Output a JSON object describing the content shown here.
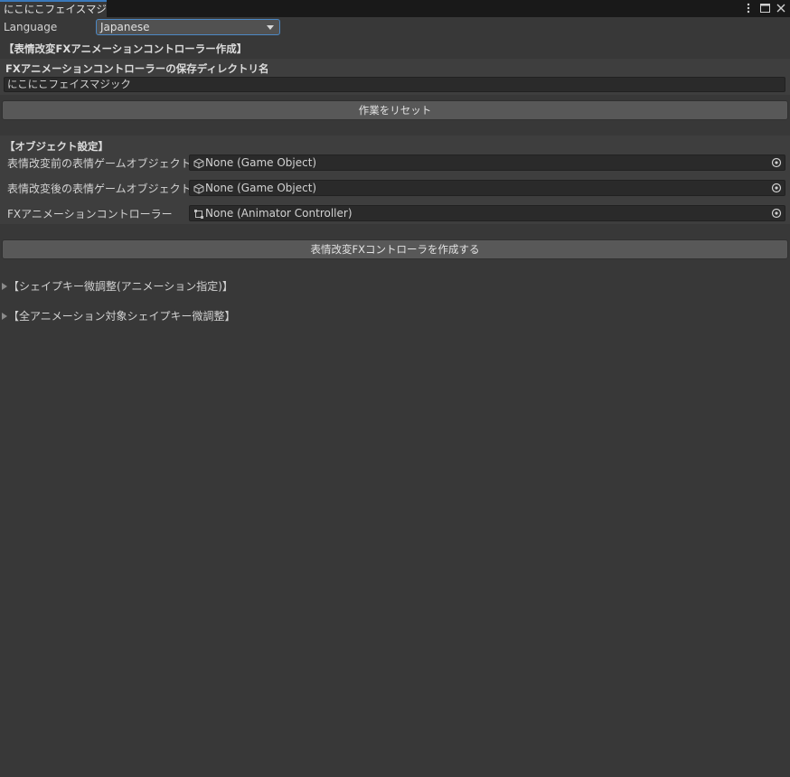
{
  "window": {
    "tab_title": "にこにこフェイスマジック",
    "controls": [
      "kebab-menu-icon",
      "maximize-icon",
      "close-icon"
    ]
  },
  "language": {
    "label": "Language",
    "selected": "Japanese"
  },
  "fx_section": {
    "header": "【表情改変FXアニメーションコントローラー作成】",
    "dir_label": "FXアニメーションコントローラーの保存ディレクトリ名",
    "dir_value": "にこにこフェイスマジック",
    "reset_button": "作業をリセット"
  },
  "object_section": {
    "header": "【オブジェクト設定】",
    "fields": [
      {
        "label": "表情改変前の表情ゲームオブジェクト",
        "value": "None (Game Object)",
        "icon": "game-object-icon"
      },
      {
        "label": "表情改変後の表情ゲームオブジェクト",
        "value": "None (Game Object)",
        "icon": "game-object-icon"
      },
      {
        "label": "FXアニメーションコントローラー",
        "value": "None (Animator Controller)",
        "icon": "animator-controller-icon"
      }
    ],
    "create_button": "表情改変FXコントローラを作成する"
  },
  "foldouts": [
    {
      "label": "【シェイプキー微調整(アニメーション指定)】"
    },
    {
      "label": "【全アニメーション対象シェイプキー微調整】"
    }
  ],
  "colors": {
    "background": "#383838",
    "tab_accent": "#3a79bb",
    "dropdown_border": "#4c88c4"
  }
}
